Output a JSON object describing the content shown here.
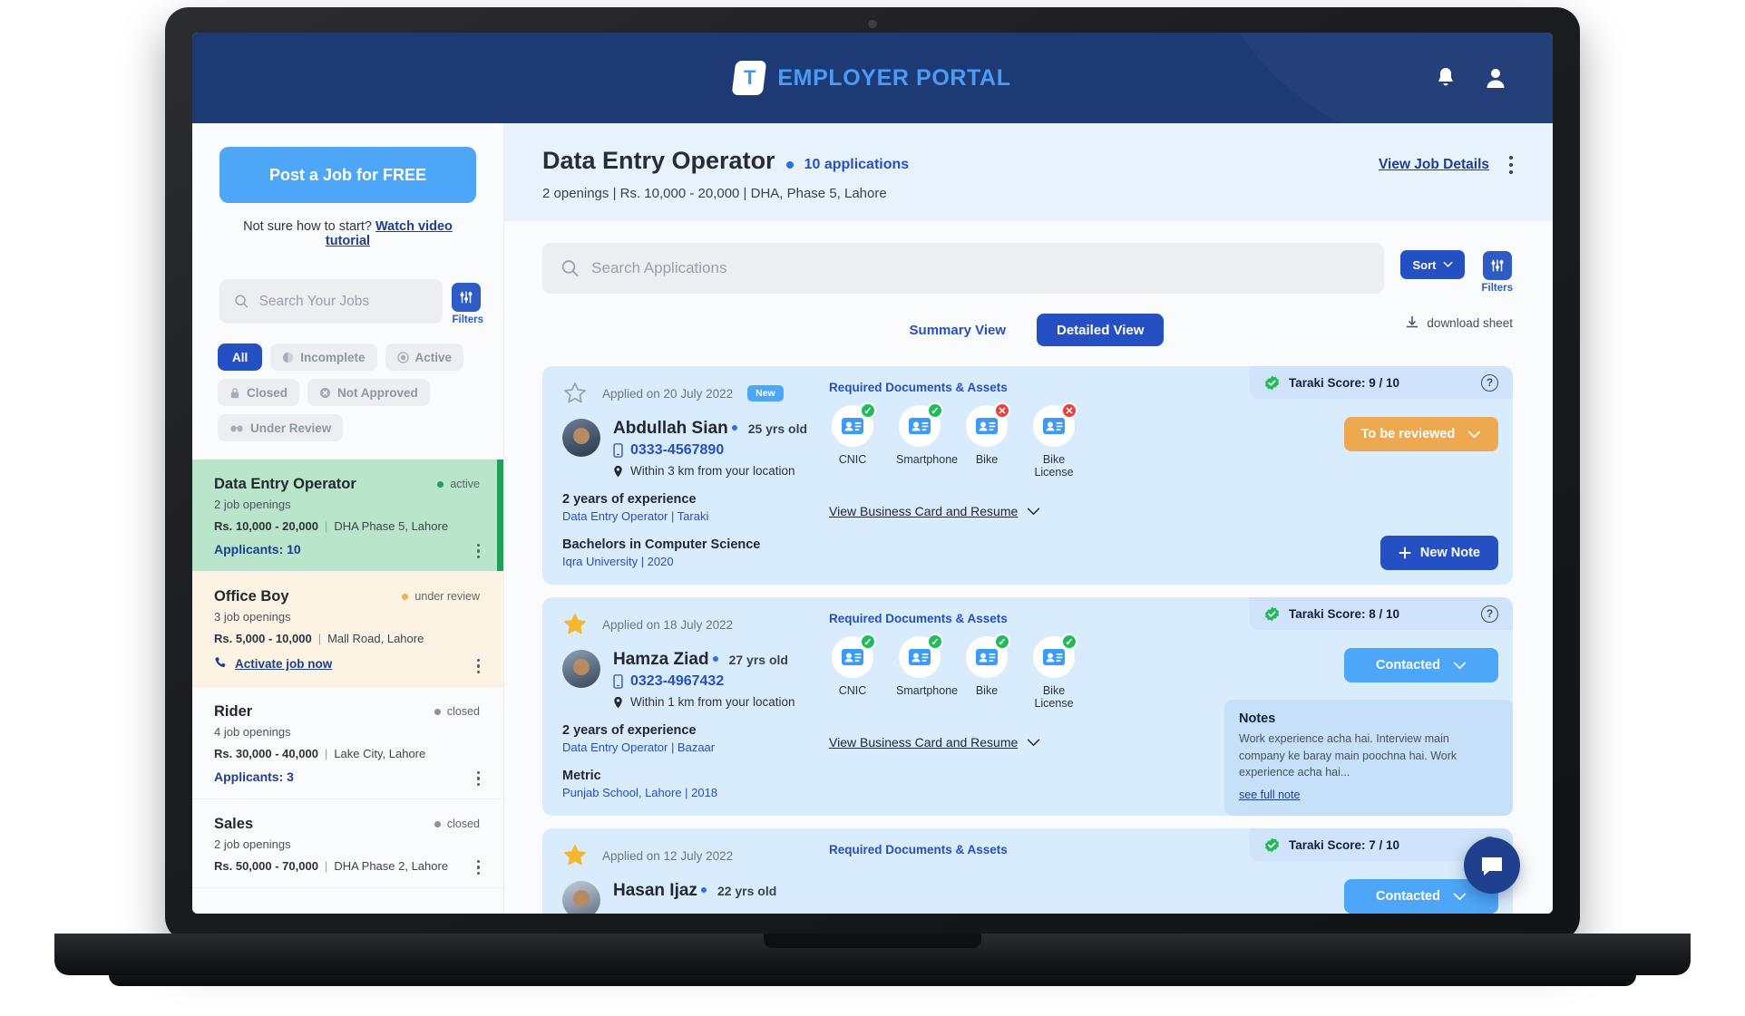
{
  "header": {
    "brand_mark": "T",
    "brand_name": "EMPLOYER PORTAL",
    "notification_icon": "bell-icon",
    "profile_icon": "user-icon"
  },
  "sidebar": {
    "post_job_label": "Post a Job for FREE",
    "helper_prefix": "Not sure how to start?",
    "helper_link": "Watch video tutorial",
    "search": {
      "placeholder": "Search Your Jobs",
      "value": ""
    },
    "filters_label": "Filters",
    "chips": [
      {
        "label": "All",
        "icon": "",
        "active": true
      },
      {
        "label": "Incomplete",
        "icon": "incomplete-icon",
        "active": false
      },
      {
        "label": "Active",
        "icon": "active-icon",
        "active": false
      },
      {
        "label": "Closed",
        "icon": "lock-icon",
        "active": false
      },
      {
        "label": "Not Approved",
        "icon": "not-approved-icon",
        "active": false
      },
      {
        "label": "Under Review",
        "icon": "under-review-icon",
        "active": false
      }
    ],
    "jobs": [
      {
        "title": "Data Entry Operator",
        "openings": "2 job openings",
        "salary": "Rs. 10,000 - 20,000",
        "location": "DHA Phase 5, Lahore",
        "applicants": "Applicants: 10",
        "status": "active",
        "state": "selected"
      },
      {
        "title": "Office Boy",
        "openings": "3 job openings",
        "salary": "Rs. 5,000 - 10,000",
        "location": "Mall Road, Lahore",
        "activate_link": "Activate job now",
        "status": "under review",
        "state": "review"
      },
      {
        "title": "Rider",
        "openings": "4 job openings",
        "salary": "Rs. 30,000 - 40,000",
        "location": "Lake City, Lahore",
        "applicants": "Applicants: 3",
        "status": "closed",
        "state": "plain"
      },
      {
        "title": "Sales",
        "openings": "2 job openings",
        "salary": "Rs. 50,000 - 70,000",
        "location": "DHA Phase 2, Lahore",
        "status": "closed",
        "state": "plain"
      }
    ]
  },
  "main": {
    "job_title": "Data Entry Operator",
    "applications_count": "10 applications",
    "subtitle": "2 openings | Rs. 10,000 - 20,000 | DHA, Phase 5, Lahore",
    "view_job_details": "View Job Details",
    "search": {
      "placeholder": "Search Applications",
      "value": ""
    },
    "sort_label": "Sort",
    "filters_label": "Filters",
    "views": [
      {
        "label": "Summary View",
        "active": false
      },
      {
        "label": "Detailed View",
        "active": true
      }
    ],
    "download_sheet": "download sheet",
    "docs_heading": "Required Documents & Assets",
    "view_business_card": "View Business Card and Resume",
    "new_note_label": "New Note",
    "candidates": [
      {
        "applied": "Applied on 20 July 2022",
        "badge": "New",
        "starred": false,
        "name": "Abdullah Sian",
        "age": "25 yrs old",
        "phone": "0333-4567890",
        "distance": "Within 3 km from your location",
        "experience": "2 years of experience",
        "experience_detail": "Data Entry Operator | Taraki",
        "education": "Bachelors in Computer Science",
        "education_detail": "Iqra University | 2020",
        "documents": [
          {
            "label": "CNIC",
            "status": "ok"
          },
          {
            "label": "Smartphone",
            "status": "ok"
          },
          {
            "label": "Bike",
            "status": "no"
          },
          {
            "label": "Bike License",
            "status": "no"
          }
        ],
        "taraki_score": "Taraki Score: 9 / 10",
        "status_label": "To be reviewed",
        "status_color": "#eda94f",
        "has_note": false
      },
      {
        "applied": "Applied on 18 July 2022",
        "badge": "",
        "starred": true,
        "name": "Hamza Ziad",
        "age": "27 yrs old",
        "phone": "0323-4967432",
        "distance": "Within 1 km from your location",
        "experience": "2 years of experience",
        "experience_detail": "Data Entry Operator | Bazaar",
        "education": "Metric",
        "education_detail": "Punjab School, Lahore | 2018",
        "documents": [
          {
            "label": "CNIC",
            "status": "ok"
          },
          {
            "label": "Smartphone",
            "status": "ok"
          },
          {
            "label": "Bike",
            "status": "ok"
          },
          {
            "label": "Bike License",
            "status": "ok"
          }
        ],
        "taraki_score": "Taraki Score: 8 / 10",
        "status_label": "Contacted",
        "status_color": "#4da6f7",
        "has_note": true,
        "notes_heading": "Notes",
        "notes_text": "Work experience acha hai. Interview main company ke baray main poochna hai. Work experience acha hai...",
        "notes_link": "see full note"
      },
      {
        "applied": "Applied on 12 July 2022",
        "badge": "",
        "starred": true,
        "name": "Hasan Ijaz",
        "age": "22 yrs old",
        "phone": "",
        "distance": "",
        "experience": "",
        "experience_detail": "",
        "education": "",
        "education_detail": "",
        "documents": [],
        "taraki_score": "Taraki Score: 7 / 10",
        "status_label": "Contacted",
        "status_color": "#4da6f7",
        "has_note": false
      }
    ],
    "chat_icon": "chat-bubble-icon"
  },
  "colors": {
    "header_blue": "#1e3a74",
    "accent_blue": "#2550c4",
    "light_blue": "#4da6f7",
    "card_blue": "#d9ecfd",
    "selected_green": "#b9e5cb",
    "review_cream": "#fdf3e2",
    "orange": "#eda94f",
    "ok_green": "#22bb5b",
    "no_red": "#e8413c"
  }
}
